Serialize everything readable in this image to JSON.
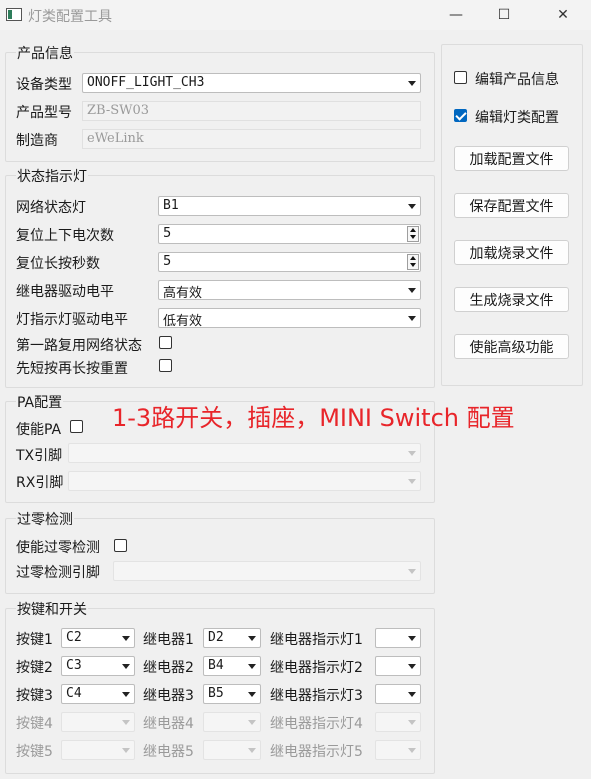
{
  "window": {
    "title": "灯类配置工具",
    "minimize": "—",
    "maximize": "☐",
    "close": "✕"
  },
  "product": {
    "group_title": "产品信息",
    "device_type_label": "设备类型",
    "device_type_value": "ONOFF_LIGHT_CH3",
    "model_label": "产品型号",
    "model_value": "ZB-SW03",
    "manufacturer_label": "制造商",
    "manufacturer_value": "eWeLink"
  },
  "status": {
    "group_title": "状态指示灯",
    "net_led_label": "网络状态灯",
    "net_led_value": "B1",
    "reset_power_label": "复位上下电次数",
    "reset_power_value": "5",
    "reset_press_label": "复位长按秒数",
    "reset_press_value": "5",
    "relay_level_label": "继电器驱动电平",
    "relay_level_value": "高有效",
    "led_level_label": "灯指示灯驱动电平",
    "led_level_value": "低有效",
    "reuse_label": "第一路复用网络状态",
    "reuse_checked": false,
    "short_long_label": "先短按再长按重置",
    "short_long_checked": false
  },
  "right_panel": {
    "edit_product_label": "编辑产品信息",
    "edit_product_checked": false,
    "edit_light_label": "编辑灯类配置",
    "edit_light_checked": true,
    "buttons": [
      "加载配置文件",
      "保存配置文件",
      "加载烧录文件",
      "生成烧录文件",
      "使能高级功能"
    ]
  },
  "overlay_text": "1-3路开关，插座，MINI Switch 配置",
  "pa": {
    "group_title": "PA配置",
    "enable_label": "使能PA",
    "enable_checked": false,
    "tx_label": "TX引脚",
    "rx_label": "RX引脚"
  },
  "zero_cross": {
    "group_title": "过零检测",
    "enable_label": "使能过零检测",
    "enable_checked": false,
    "pin_label": "过零检测引脚"
  },
  "keys": {
    "group_title": "按键和开关",
    "rows": [
      {
        "key_label": "按键1",
        "key_value": "C2",
        "relay_label": "继电器1",
        "relay_value": "D2",
        "led_label": "继电器指示灯1",
        "led_value": "",
        "enabled": true
      },
      {
        "key_label": "按键2",
        "key_value": "C3",
        "relay_label": "继电器2",
        "relay_value": "B4",
        "led_label": "继电器指示灯2",
        "led_value": "",
        "enabled": true
      },
      {
        "key_label": "按键3",
        "key_value": "C4",
        "relay_label": "继电器3",
        "relay_value": "B5",
        "led_label": "继电器指示灯3",
        "led_value": "",
        "enabled": true
      },
      {
        "key_label": "按键4",
        "key_value": "",
        "relay_label": "继电器4",
        "relay_value": "",
        "led_label": "继电器指示灯4",
        "led_value": "",
        "enabled": false
      },
      {
        "key_label": "按键5",
        "key_value": "",
        "relay_label": "继电器5",
        "relay_value": "",
        "led_label": "继电器指示灯5",
        "led_value": "",
        "enabled": false
      }
    ]
  }
}
